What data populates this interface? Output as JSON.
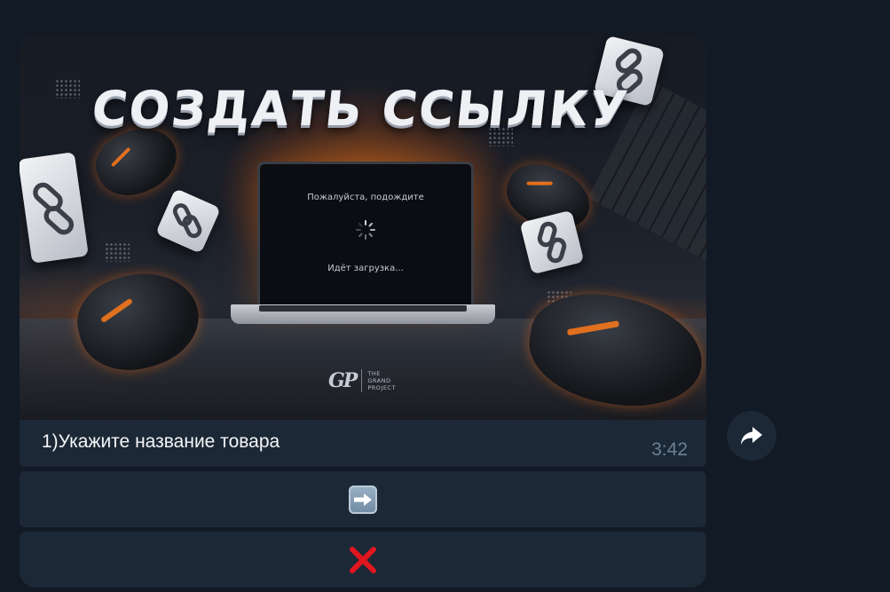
{
  "message": {
    "photo": {
      "headline": "СОЗДАТЬ ССЫЛКУ",
      "laptop_top_text": "Пожалуйста, подождите",
      "laptop_bottom_text": "Идёт загрузка...",
      "brand_mark": "GP",
      "brand_name": "THE\nGRAND\nPROJECT"
    },
    "caption": "1)Укажите название товара",
    "time": "3:42"
  },
  "inline_keyboard": [
    {
      "icon": "right-arrow-emoji-icon"
    },
    {
      "icon": "cross-mark-emoji-icon"
    }
  ],
  "share_button": {
    "icon": "share-arrow-icon"
  },
  "colors": {
    "background": "#111a25",
    "bubble": "#1c2836",
    "time": "#6d7f93",
    "accent_orange": "#ff7a1a",
    "cross_red": "#e0161e"
  }
}
